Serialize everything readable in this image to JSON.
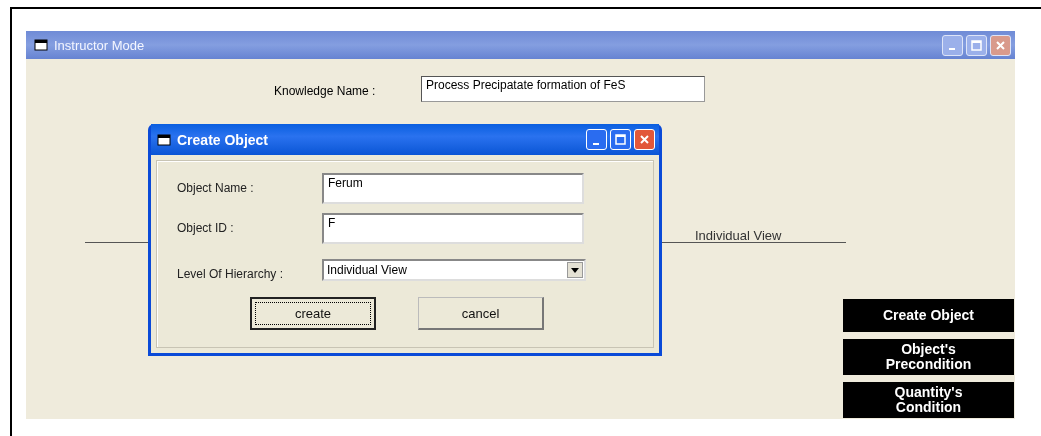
{
  "main_window": {
    "title": "Instructor Mode",
    "active": false
  },
  "knowledge_name": {
    "label": "Knowledge  Name :",
    "value": "Process Precipatate formation of FeS"
  },
  "hierarchy_line": {
    "label": "Individual View"
  },
  "dialog": {
    "title": "Create Object",
    "active": true,
    "fields": [
      {
        "kind": "text",
        "label": "Object Name :",
        "value": "Ferum"
      },
      {
        "kind": "text",
        "label": "Object ID :",
        "value": "F"
      },
      {
        "kind": "dropdown",
        "label": "Level Of Hierarchy :",
        "value": "Individual View"
      }
    ],
    "buttons": [
      {
        "label": "create",
        "focused": true
      },
      {
        "label": "cancel",
        "focused": false
      }
    ]
  },
  "side_buttons": [
    "Create Object",
    "Object's\nPrecondition",
    "Quantity's\nCondition"
  ]
}
